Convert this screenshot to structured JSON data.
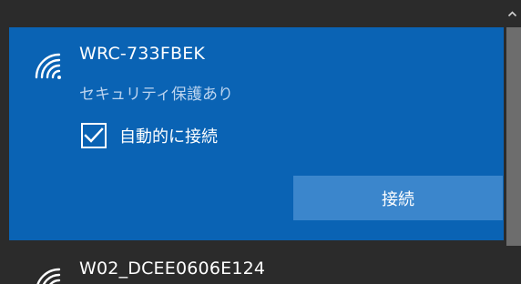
{
  "networks": [
    {
      "name": "WRC-733FBEK",
      "status": "セキュリティ保護あり",
      "auto_connect_label": "自動的に接続",
      "auto_connect_checked": true,
      "connect_label": "接続",
      "icon": "wifi-icon"
    },
    {
      "name": "W02_DCEE0606E124",
      "icon": "wifi-icon"
    }
  ],
  "scrollbar": {
    "up_arrow_icon": "chevron-up-icon"
  },
  "colors": {
    "selected_background": "#0a63b4",
    "connect_button": "#3b86cc",
    "panel_background": "#2b2b2b",
    "status_text": "#bcd4ef"
  }
}
